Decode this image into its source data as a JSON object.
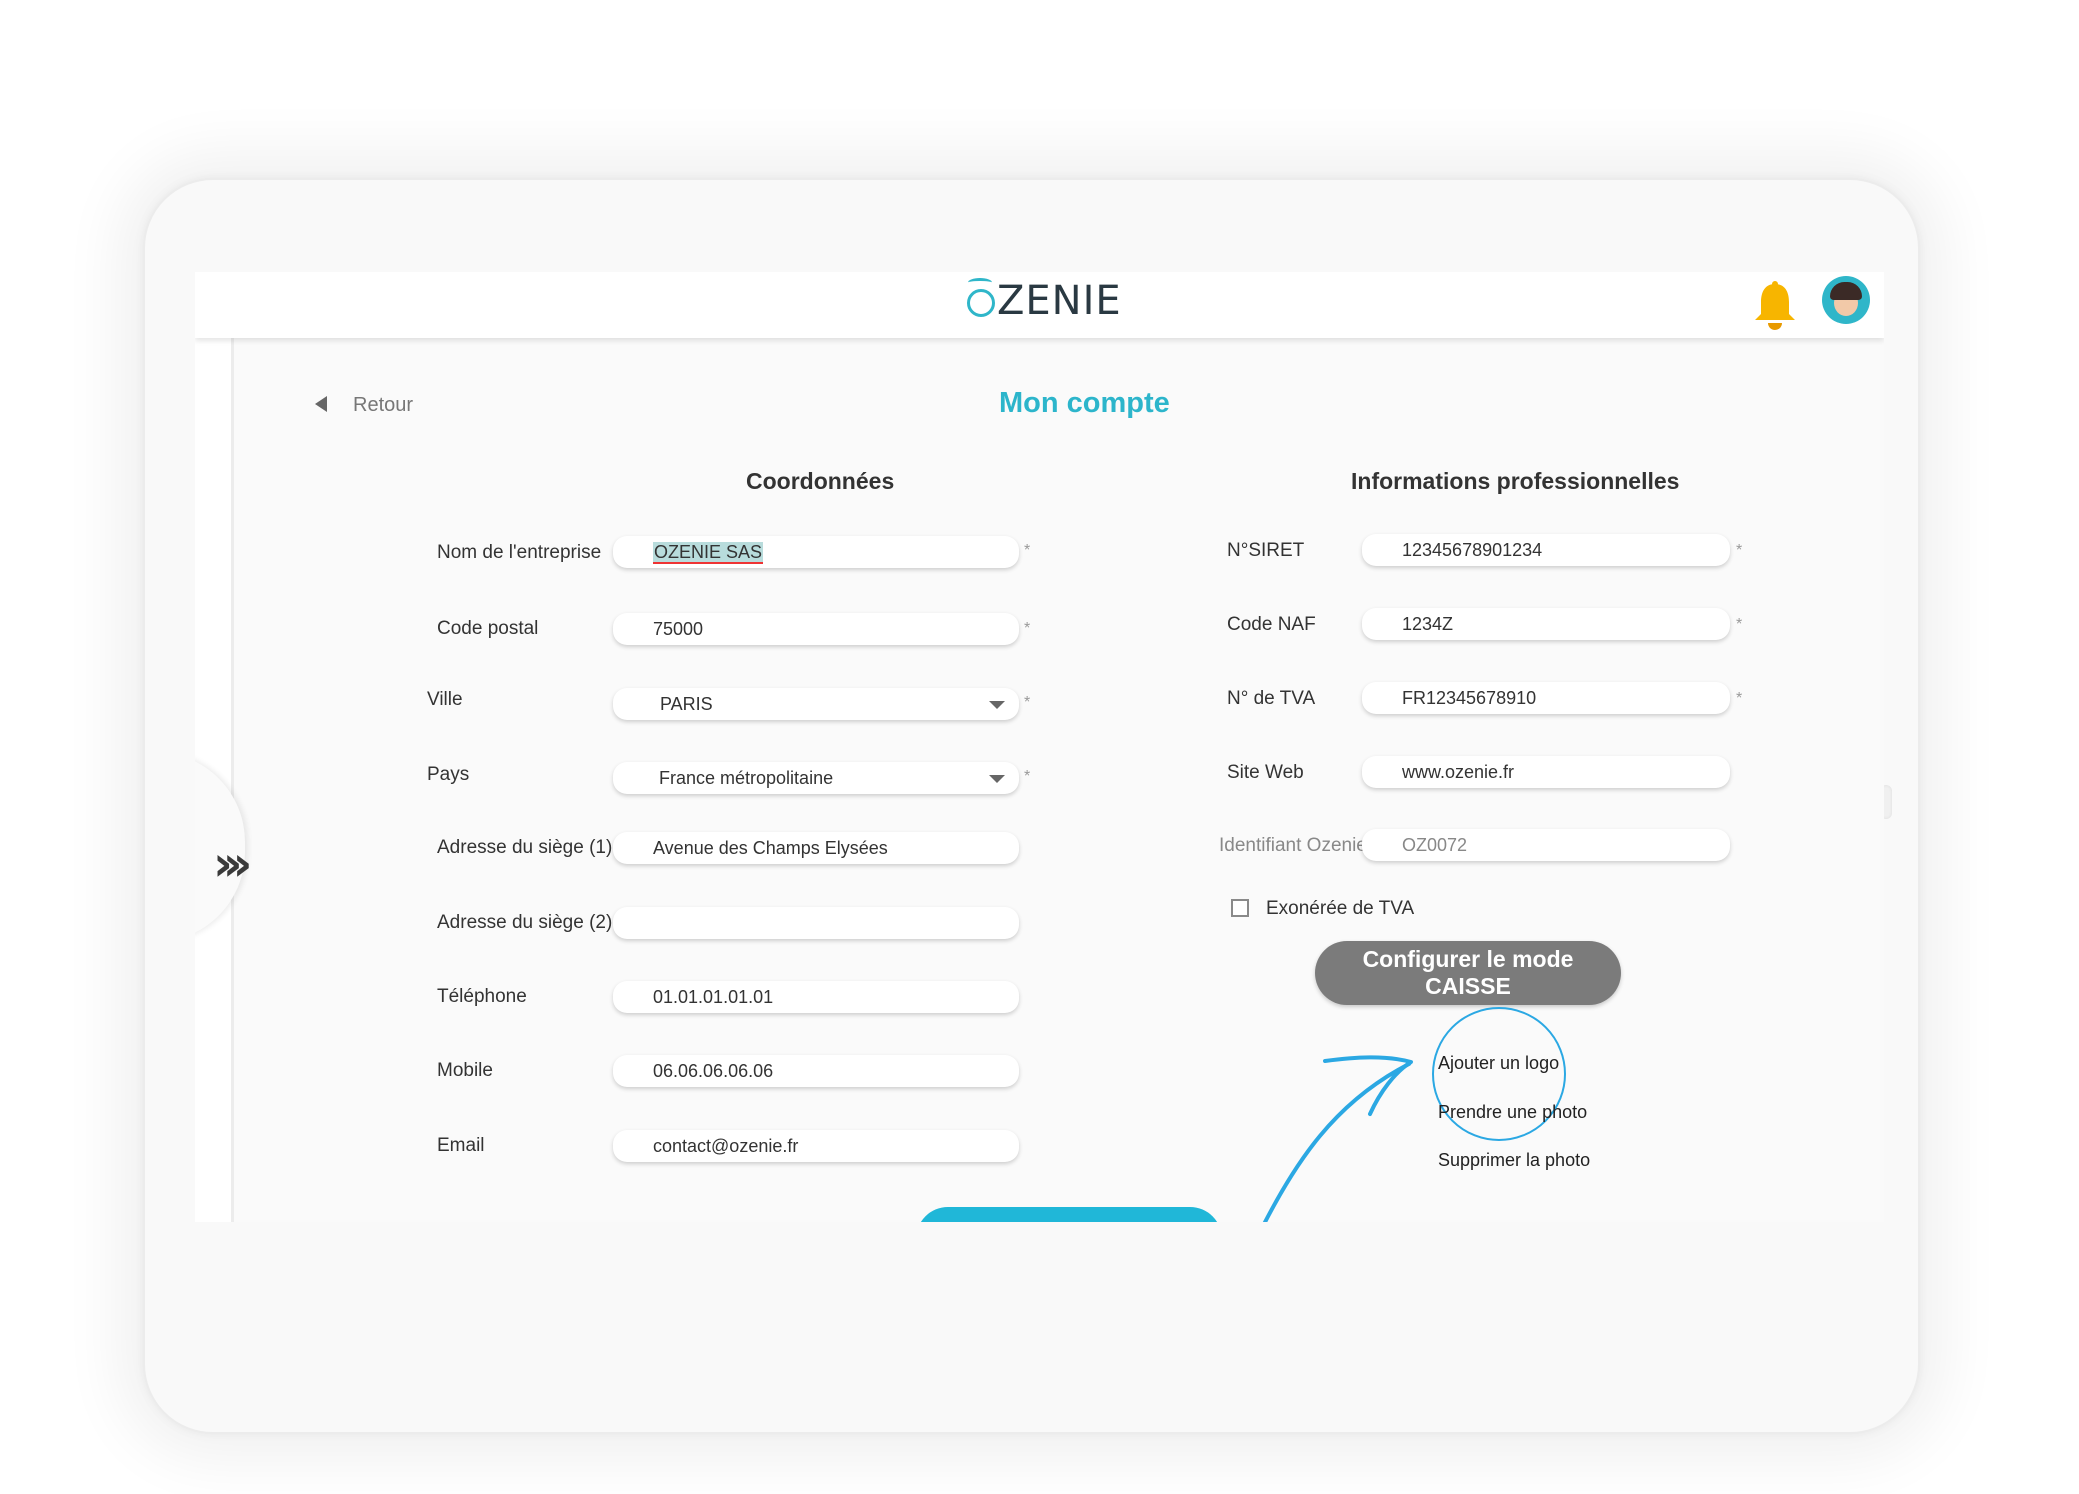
{
  "header": {
    "logo_text": "ZENIE",
    "bell_icon": "bell-icon",
    "avatar_icon": "avatar-icon",
    "accent_color": "#2fb6c9"
  },
  "nav": {
    "back_label": "Retour",
    "drawer_icon": "double-chevron-right-icon"
  },
  "page": {
    "title": "Mon compte"
  },
  "coordonnees": {
    "title": "Coordonnées",
    "nom_label": "Nom de l'entreprise",
    "nom_value": "OZENIE SAS",
    "cp_label": "Code postal",
    "cp_value": "75000",
    "ville_label": "Ville",
    "ville_value": "PARIS",
    "pays_label": "Pays",
    "pays_value": "France métropolitaine",
    "adr1_label": "Adresse du siège (1)",
    "adr1_value": "Avenue des Champs Elysées",
    "adr2_label": "Adresse du siège (2)",
    "adr2_value": "",
    "tel_label": "Téléphone",
    "tel_value": "01.01.01.01.01",
    "mobile_label": "Mobile",
    "mobile_value": "06.06.06.06.06",
    "email_label": "Email",
    "email_value": "contact@ozenie.fr",
    "required_mark": "*"
  },
  "pro": {
    "title": "Informations professionnelles",
    "siret_label": "N°SIRET",
    "siret_value": "12345678901234",
    "naf_label": "Code NAF",
    "naf_value": "1234Z",
    "tva_label": "N° de TVA",
    "tva_value": "FR12345678910",
    "web_label": "Site Web",
    "web_value": "www.ozenie.fr",
    "id_label": "Identifiant Ozenie",
    "id_value": "OZ0072",
    "exo_label": "Exonérée de TVA",
    "caisse_button": "Configurer le mode CAISSE"
  },
  "logo_menu": {
    "add": "Ajouter un logo",
    "photo": "Prendre une photo",
    "delete": "Supprimer la photo"
  }
}
